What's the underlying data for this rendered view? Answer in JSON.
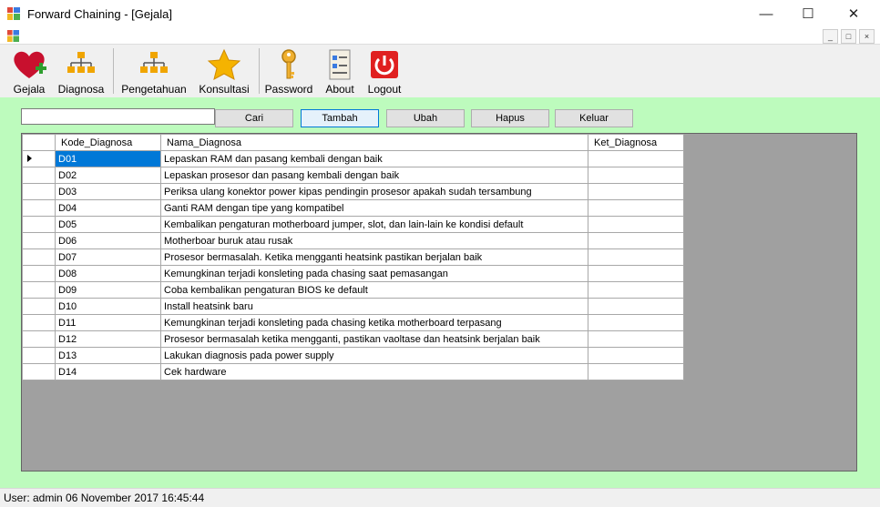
{
  "window": {
    "title": "Forward Chaining - [Gejala]"
  },
  "toolbar": {
    "items": [
      {
        "label": "Gejala",
        "icon": "heart-plus-icon"
      },
      {
        "label": "Diagnosa",
        "icon": "hierarchy-icon"
      },
      {
        "label": "Pengetahuan",
        "icon": "hierarchy-icon"
      },
      {
        "label": "Konsultasi",
        "icon": "star-icon"
      },
      {
        "label": "Password",
        "icon": "key-icon"
      },
      {
        "label": "About",
        "icon": "document-icon"
      },
      {
        "label": "Logout",
        "icon": "power-icon"
      }
    ]
  },
  "search": {
    "value": ""
  },
  "buttons": {
    "cari": "Cari",
    "tambah": "Tambah",
    "ubah": "Ubah",
    "hapus": "Hapus",
    "keluar": "Keluar"
  },
  "table": {
    "columns": [
      "Kode_Diagnosa",
      "Nama_Diagnosa",
      "Ket_Diagnosa"
    ],
    "rows": [
      {
        "kode": "D01",
        "nama": "Lepaskan RAM dan pasang kembali dengan baik",
        "ket": ""
      },
      {
        "kode": "D02",
        "nama": "Lepaskan prosesor dan pasang kembali dengan baik",
        "ket": ""
      },
      {
        "kode": "D03",
        "nama": "Periksa ulang konektor power kipas pendingin prosesor apakah sudah tersambung",
        "ket": ""
      },
      {
        "kode": "D04",
        "nama": "Ganti RAM dengan tipe yang kompatibel",
        "ket": ""
      },
      {
        "kode": "D05",
        "nama": "Kembalikan pengaturan motherboard jumper, slot, dan lain-lain ke kondisi default",
        "ket": ""
      },
      {
        "kode": "D06",
        "nama": "Motherboar buruk atau rusak",
        "ket": ""
      },
      {
        "kode": "D07",
        "nama": "Prosesor bermasalah. Ketika mengganti heatsink pastikan berjalan baik",
        "ket": ""
      },
      {
        "kode": "D08",
        "nama": "Kemungkinan terjadi konsleting pada chasing saat pemasangan",
        "ket": ""
      },
      {
        "kode": "D09",
        "nama": "Coba kembalikan pengaturan BIOS ke default",
        "ket": ""
      },
      {
        "kode": "D10",
        "nama": "Install heatsink baru",
        "ket": ""
      },
      {
        "kode": "D11",
        "nama": "Kemungkinan terjadi konsleting pada chasing ketika motherboard terpasang",
        "ket": ""
      },
      {
        "kode": "D12",
        "nama": "Prosesor bermasalah ketika mengganti, pastikan vaoltase dan heatsink berjalan baik",
        "ket": ""
      },
      {
        "kode": "D13",
        "nama": "Lakukan diagnosis pada power supply",
        "ket": ""
      },
      {
        "kode": "D14",
        "nama": "Cek hardware",
        "ket": ""
      }
    ]
  },
  "status": {
    "text": "User: admin  06 November 2017 16:45:44"
  },
  "colors": {
    "main_bg": "#bdfbbd",
    "selection": "#0078d7",
    "grid_bg": "#a0a0a0"
  }
}
